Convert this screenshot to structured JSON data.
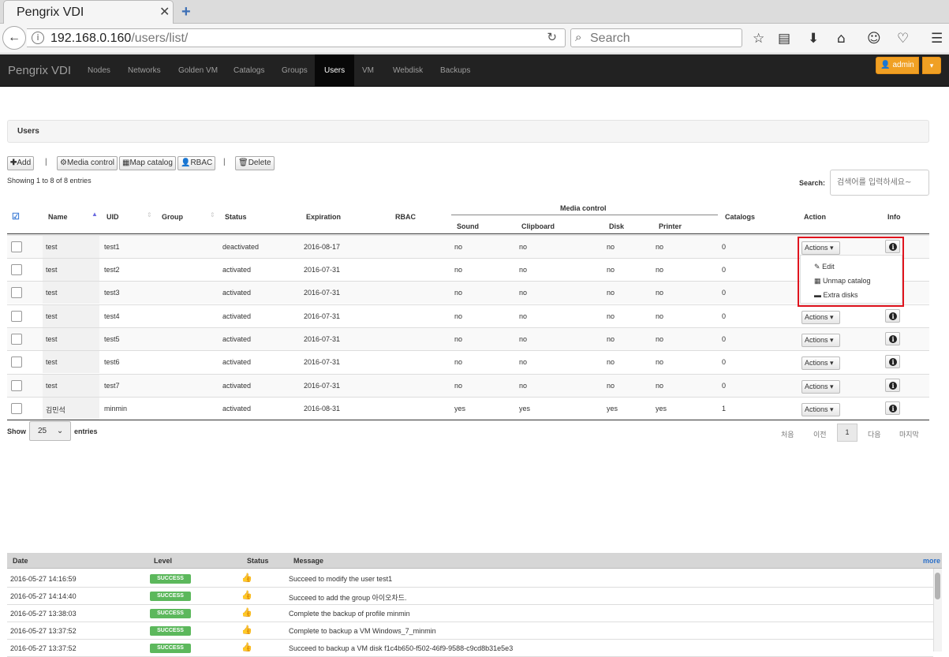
{
  "browser": {
    "tab_title": "Pengrix VDI",
    "url_host": "192.168.0.160",
    "url_path": "/users/list/",
    "search_placeholder": "Search"
  },
  "app": {
    "brand": "Pengrix VDI",
    "nav": [
      "Nodes",
      "Networks",
      "Golden VM",
      "Catalogs",
      "Groups",
      "Users",
      "VM",
      "Webdisk",
      "Backups"
    ],
    "active_nav": "Users",
    "user": "admin"
  },
  "page": {
    "breadcrumb": "Users",
    "toolbar": {
      "add": "Add",
      "media_control": "Media control",
      "map_catalog": "Map catalog",
      "rbac": "RBAC",
      "delete": "Delete"
    },
    "showing": "Showing 1 to 8 of 8 entries",
    "search_label": "Search:",
    "search_placeholder": "검색어를 입력하세요~"
  },
  "table": {
    "headers": {
      "name": "Name",
      "uid": "UID",
      "group": "Group",
      "status": "Status",
      "expiration": "Expiration",
      "rbac": "RBAC",
      "media_control": "Media control",
      "sound": "Sound",
      "clipboard": "Clipboard",
      "disk": "Disk",
      "printer": "Printer",
      "catalogs": "Catalogs",
      "action": "Action",
      "info": "Info"
    },
    "rows": [
      {
        "name": "test",
        "uid": "test1",
        "group": "",
        "status": "deactivated",
        "expiration": "2016-08-17",
        "rbac": "",
        "sound": "no",
        "clipboard": "no",
        "disk": "no",
        "printer": "no",
        "catalogs": "0"
      },
      {
        "name": "test",
        "uid": "test2",
        "group": "",
        "status": "activated",
        "expiration": "2016-07-31",
        "rbac": "",
        "sound": "no",
        "clipboard": "no",
        "disk": "no",
        "printer": "no",
        "catalogs": "0"
      },
      {
        "name": "test",
        "uid": "test3",
        "group": "",
        "status": "activated",
        "expiration": "2016-07-31",
        "rbac": "",
        "sound": "no",
        "clipboard": "no",
        "disk": "no",
        "printer": "no",
        "catalogs": "0"
      },
      {
        "name": "test",
        "uid": "test4",
        "group": "",
        "status": "activated",
        "expiration": "2016-07-31",
        "rbac": "",
        "sound": "no",
        "clipboard": "no",
        "disk": "no",
        "printer": "no",
        "catalogs": "0"
      },
      {
        "name": "test",
        "uid": "test5",
        "group": "",
        "status": "activated",
        "expiration": "2016-07-31",
        "rbac": "",
        "sound": "no",
        "clipboard": "no",
        "disk": "no",
        "printer": "no",
        "catalogs": "0"
      },
      {
        "name": "test",
        "uid": "test6",
        "group": "",
        "status": "activated",
        "expiration": "2016-07-31",
        "rbac": "",
        "sound": "no",
        "clipboard": "no",
        "disk": "no",
        "printer": "no",
        "catalogs": "0"
      },
      {
        "name": "test",
        "uid": "test7",
        "group": "",
        "status": "activated",
        "expiration": "2016-07-31",
        "rbac": "",
        "sound": "no",
        "clipboard": "no",
        "disk": "no",
        "printer": "no",
        "catalogs": "0"
      },
      {
        "name": "김민석",
        "uid": "minmin",
        "group": "",
        "status": "activated",
        "expiration": "2016-08-31",
        "rbac": "",
        "sound": "yes",
        "clipboard": "yes",
        "disk": "yes",
        "printer": "yes",
        "catalogs": "1"
      }
    ],
    "action_label": "Actions",
    "dropdown": [
      "Edit",
      "Unmap catalog",
      "Extra disks"
    ]
  },
  "pager": {
    "show": "Show",
    "length": "25",
    "entries": "entries",
    "first": "처음",
    "prev": "이전",
    "current": "1",
    "next": "다음",
    "last": "마지막"
  },
  "log": {
    "headers": {
      "date": "Date",
      "level": "Level",
      "status": "Status",
      "message": "Message"
    },
    "more": "more",
    "rows": [
      {
        "date": "2016-05-27 14:16:59",
        "level": "SUCCESS",
        "message": "Succeed to modify the user test1"
      },
      {
        "date": "2016-05-27 14:14:40",
        "level": "SUCCESS",
        "message": "Succeed to add the group 아이오차드."
      },
      {
        "date": "2016-05-27 13:38:03",
        "level": "SUCCESS",
        "message": "Complete the backup of profile minmin"
      },
      {
        "date": "2016-05-27 13:37:52",
        "level": "SUCCESS",
        "message": "Complete to backup a VM Windows_7_minmin"
      },
      {
        "date": "2016-05-27 13:37:52",
        "level": "SUCCESS",
        "message": "Succeed to backup a VM disk f1c4b650-f502-46f9-9588-c9cd8b31e5e3"
      }
    ]
  },
  "colors": {
    "accent": "#f0a024",
    "nav_bg": "#222222",
    "success": "#5cb85c",
    "highlight": "#e0141e",
    "link": "#2a6fc9"
  }
}
